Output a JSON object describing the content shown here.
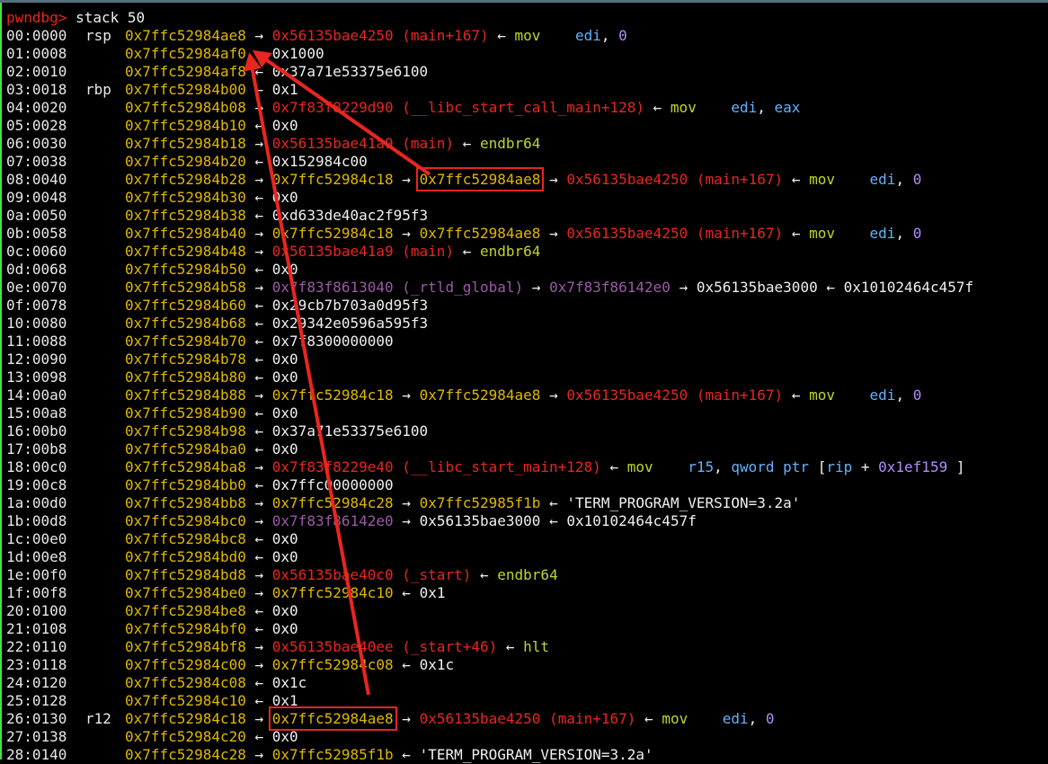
{
  "prompt": "pwndbg>",
  "command": "stack 50",
  "arrows": {
    "forward": "→",
    "back": "←"
  },
  "colors": {
    "stack": "#e0b800",
    "code": "#e8261f",
    "rwx": "#9b5aa6",
    "instr": "#c2d42a",
    "register": "#63b2ff",
    "immediate": "#b28cff",
    "highlight": "#e8261f"
  },
  "rows": [
    {
      "off": "00:0000",
      "reg": "rsp",
      "addr": "0x7ffc52984ae8",
      "chain": [
        {
          "t": "a",
          "v": "→"
        },
        {
          "t": "code",
          "v": "0x56135bae4250 (main+167)"
        },
        {
          "t": "a",
          "v": "←"
        },
        {
          "t": "instr",
          "v": "mov    "
        },
        {
          "t": "opr",
          "v": "edi"
        },
        {
          "t": "plain",
          "v": ", "
        },
        {
          "t": "imm",
          "v": "0"
        }
      ]
    },
    {
      "off": "01:0008",
      "reg": "",
      "addr": "0x7ffc52984af0",
      "chain": [
        {
          "t": "a",
          "v": "←"
        },
        {
          "t": "plain",
          "v": "0x1000"
        }
      ]
    },
    {
      "off": "02:0010",
      "reg": "",
      "addr": "0x7ffc52984af8",
      "chain": [
        {
          "t": "a",
          "v": "←"
        },
        {
          "t": "plain",
          "v": "0x37a71e53375e6100"
        }
      ]
    },
    {
      "off": "03:0018",
      "reg": "rbp",
      "addr": "0x7ffc52984b00",
      "chain": [
        {
          "t": "a",
          "v": "←"
        },
        {
          "t": "plain",
          "v": "0x1"
        }
      ]
    },
    {
      "off": "04:0020",
      "reg": "",
      "addr": "0x7ffc52984b08",
      "chain": [
        {
          "t": "a",
          "v": "→"
        },
        {
          "t": "code",
          "v": "0x7f83f8229d90 (__libc_start_call_main+128)"
        },
        {
          "t": "a",
          "v": "←"
        },
        {
          "t": "instr",
          "v": "mov    "
        },
        {
          "t": "opr",
          "v": "edi"
        },
        {
          "t": "plain",
          "v": ", "
        },
        {
          "t": "opr",
          "v": "eax"
        }
      ]
    },
    {
      "off": "05:0028",
      "reg": "",
      "addr": "0x7ffc52984b10",
      "chain": [
        {
          "t": "a",
          "v": "←"
        },
        {
          "t": "plain",
          "v": "0x0"
        }
      ]
    },
    {
      "off": "06:0030",
      "reg": "",
      "addr": "0x7ffc52984b18",
      "chain": [
        {
          "t": "a",
          "v": "→"
        },
        {
          "t": "code",
          "v": "0x56135bae41a9 (main)"
        },
        {
          "t": "a",
          "v": "←"
        },
        {
          "t": "instr",
          "v": "endbr64"
        }
      ]
    },
    {
      "off": "07:0038",
      "reg": "",
      "addr": "0x7ffc52984b20",
      "chain": [
        {
          "t": "a",
          "v": "←"
        },
        {
          "t": "plain",
          "v": "0x152984c00"
        }
      ]
    },
    {
      "off": "08:0040",
      "reg": "",
      "addr": "0x7ffc52984b28",
      "chain": [
        {
          "t": "a",
          "v": "→"
        },
        {
          "t": "sp",
          "v": "0x7ffc52984c18"
        },
        {
          "t": "a",
          "v": "→"
        },
        {
          "t": "sp",
          "v": "0x7ffc52984ae8",
          "hl": true
        },
        {
          "t": "a",
          "v": "→"
        },
        {
          "t": "code",
          "v": "0x56135bae4250 (main+167)"
        },
        {
          "t": "a",
          "v": "←"
        },
        {
          "t": "instr",
          "v": "mov    "
        },
        {
          "t": "opr",
          "v": "edi"
        },
        {
          "t": "plain",
          "v": ", "
        },
        {
          "t": "imm",
          "v": "0"
        }
      ]
    },
    {
      "off": "09:0048",
      "reg": "",
      "addr": "0x7ffc52984b30",
      "chain": [
        {
          "t": "a",
          "v": "←"
        },
        {
          "t": "plain",
          "v": "0x0"
        }
      ]
    },
    {
      "off": "0a:0050",
      "reg": "",
      "addr": "0x7ffc52984b38",
      "chain": [
        {
          "t": "a",
          "v": "←"
        },
        {
          "t": "plain",
          "v": "0xd633de40ac2f95f3"
        }
      ]
    },
    {
      "off": "0b:0058",
      "reg": "",
      "addr": "0x7ffc52984b40",
      "chain": [
        {
          "t": "a",
          "v": "→"
        },
        {
          "t": "sp",
          "v": "0x7ffc52984c18"
        },
        {
          "t": "a",
          "v": "→"
        },
        {
          "t": "sp",
          "v": "0x7ffc52984ae8"
        },
        {
          "t": "a",
          "v": "→"
        },
        {
          "t": "code",
          "v": "0x56135bae4250 (main+167)"
        },
        {
          "t": "a",
          "v": "←"
        },
        {
          "t": "instr",
          "v": "mov    "
        },
        {
          "t": "opr",
          "v": "edi"
        },
        {
          "t": "plain",
          "v": ", "
        },
        {
          "t": "imm",
          "v": "0"
        }
      ]
    },
    {
      "off": "0c:0060",
      "reg": "",
      "addr": "0x7ffc52984b48",
      "chain": [
        {
          "t": "a",
          "v": "→"
        },
        {
          "t": "code",
          "v": "0x56135bae41a9 (main)"
        },
        {
          "t": "a",
          "v": "←"
        },
        {
          "t": "instr",
          "v": "endbr64"
        }
      ]
    },
    {
      "off": "0d:0068",
      "reg": "",
      "addr": "0x7ffc52984b50",
      "chain": [
        {
          "t": "a",
          "v": "←"
        },
        {
          "t": "plain",
          "v": "0x0"
        }
      ]
    },
    {
      "off": "0e:0070",
      "reg": "",
      "addr": "0x7ffc52984b58",
      "chain": [
        {
          "t": "a",
          "v": "→"
        },
        {
          "t": "rwx",
          "v": "0x7f83f8613040 (_rtld_global)"
        },
        {
          "t": "a",
          "v": "→"
        },
        {
          "t": "rwx",
          "v": "0x7f83f86142e0"
        },
        {
          "t": "a",
          "v": "→"
        },
        {
          "t": "plain",
          "v": "0x56135bae3000"
        },
        {
          "t": "a",
          "v": "←"
        },
        {
          "t": "plain",
          "v": "0x10102464c457f"
        }
      ]
    },
    {
      "off": "0f:0078",
      "reg": "",
      "addr": "0x7ffc52984b60",
      "chain": [
        {
          "t": "a",
          "v": "←"
        },
        {
          "t": "plain",
          "v": "0x29cb7b703a0d95f3"
        }
      ]
    },
    {
      "off": "10:0080",
      "reg": "",
      "addr": "0x7ffc52984b68",
      "chain": [
        {
          "t": "a",
          "v": "←"
        },
        {
          "t": "plain",
          "v": "0x29342e0596a595f3"
        }
      ]
    },
    {
      "off": "11:0088",
      "reg": "",
      "addr": "0x7ffc52984b70",
      "chain": [
        {
          "t": "a",
          "v": "←"
        },
        {
          "t": "plain",
          "v": "0x7f8300000000"
        }
      ]
    },
    {
      "off": "12:0090",
      "reg": "",
      "addr": "0x7ffc52984b78",
      "chain": [
        {
          "t": "a",
          "v": "←"
        },
        {
          "t": "plain",
          "v": "0x0"
        }
      ]
    },
    {
      "off": "13:0098",
      "reg": "",
      "addr": "0x7ffc52984b80",
      "chain": [
        {
          "t": "a",
          "v": "←"
        },
        {
          "t": "plain",
          "v": "0x0"
        }
      ]
    },
    {
      "off": "14:00a0",
      "reg": "",
      "addr": "0x7ffc52984b88",
      "chain": [
        {
          "t": "a",
          "v": "→"
        },
        {
          "t": "sp",
          "v": "0x7ffc52984c18"
        },
        {
          "t": "a",
          "v": "→"
        },
        {
          "t": "sp",
          "v": "0x7ffc52984ae8"
        },
        {
          "t": "a",
          "v": "→"
        },
        {
          "t": "code",
          "v": "0x56135bae4250 (main+167)"
        },
        {
          "t": "a",
          "v": "←"
        },
        {
          "t": "instr",
          "v": "mov    "
        },
        {
          "t": "opr",
          "v": "edi"
        },
        {
          "t": "plain",
          "v": ", "
        },
        {
          "t": "imm",
          "v": "0"
        }
      ]
    },
    {
      "off": "15:00a8",
      "reg": "",
      "addr": "0x7ffc52984b90",
      "chain": [
        {
          "t": "a",
          "v": "←"
        },
        {
          "t": "plain",
          "v": "0x0"
        }
      ]
    },
    {
      "off": "16:00b0",
      "reg": "",
      "addr": "0x7ffc52984b98",
      "chain": [
        {
          "t": "a",
          "v": "←"
        },
        {
          "t": "plain",
          "v": "0x37a71e53375e6100"
        }
      ]
    },
    {
      "off": "17:00b8",
      "reg": "",
      "addr": "0x7ffc52984ba0",
      "chain": [
        {
          "t": "a",
          "v": "←"
        },
        {
          "t": "plain",
          "v": "0x0"
        }
      ]
    },
    {
      "off": "18:00c0",
      "reg": "",
      "addr": "0x7ffc52984ba8",
      "chain": [
        {
          "t": "a",
          "v": "→"
        },
        {
          "t": "code",
          "v": "0x7f83f8229e40 (__libc_start_main+128)"
        },
        {
          "t": "a",
          "v": "←"
        },
        {
          "t": "instr",
          "v": "mov    "
        },
        {
          "t": "opr",
          "v": "r15"
        },
        {
          "t": "plain",
          "v": ", "
        },
        {
          "t": "opr",
          "v": "qword ptr"
        },
        {
          "t": "plain",
          "v": " ["
        },
        {
          "t": "opr",
          "v": "rip"
        },
        {
          "t": "plain",
          "v": " + "
        },
        {
          "t": "imm",
          "v": "0x1ef159"
        },
        {
          "t": "plain",
          "v": "]"
        }
      ]
    },
    {
      "off": "19:00c8",
      "reg": "",
      "addr": "0x7ffc52984bb0",
      "chain": [
        {
          "t": "a",
          "v": "←"
        },
        {
          "t": "plain",
          "v": "0x7ffc00000000"
        }
      ]
    },
    {
      "off": "1a:00d0",
      "reg": "",
      "addr": "0x7ffc52984bb8",
      "chain": [
        {
          "t": "a",
          "v": "→"
        },
        {
          "t": "sp",
          "v": "0x7ffc52984c28"
        },
        {
          "t": "a",
          "v": "→"
        },
        {
          "t": "sp",
          "v": "0x7ffc52985f1b"
        },
        {
          "t": "a",
          "v": "←"
        },
        {
          "t": "plain",
          "v": "'TERM_PROGRAM_VERSION=3.2a'"
        }
      ]
    },
    {
      "off": "1b:00d8",
      "reg": "",
      "addr": "0x7ffc52984bc0",
      "chain": [
        {
          "t": "a",
          "v": "→"
        },
        {
          "t": "rwx",
          "v": "0x7f83f86142e0"
        },
        {
          "t": "a",
          "v": "→"
        },
        {
          "t": "plain",
          "v": "0x56135bae3000"
        },
        {
          "t": "a",
          "v": "←"
        },
        {
          "t": "plain",
          "v": "0x10102464c457f"
        }
      ]
    },
    {
      "off": "1c:00e0",
      "reg": "",
      "addr": "0x7ffc52984bc8",
      "chain": [
        {
          "t": "a",
          "v": "←"
        },
        {
          "t": "plain",
          "v": "0x0"
        }
      ]
    },
    {
      "off": "1d:00e8",
      "reg": "",
      "addr": "0x7ffc52984bd0",
      "chain": [
        {
          "t": "a",
          "v": "←"
        },
        {
          "t": "plain",
          "v": "0x0"
        }
      ]
    },
    {
      "off": "1e:00f0",
      "reg": "",
      "addr": "0x7ffc52984bd8",
      "chain": [
        {
          "t": "a",
          "v": "→"
        },
        {
          "t": "code",
          "v": "0x56135bae40c0 (_start)"
        },
        {
          "t": "a",
          "v": "←"
        },
        {
          "t": "instr",
          "v": "endbr64"
        }
      ]
    },
    {
      "off": "1f:00f8",
      "reg": "",
      "addr": "0x7ffc52984be0",
      "chain": [
        {
          "t": "a",
          "v": "→"
        },
        {
          "t": "sp",
          "v": "0x7ffc52984c10"
        },
        {
          "t": "a",
          "v": "←"
        },
        {
          "t": "plain",
          "v": "0x1"
        }
      ]
    },
    {
      "off": "20:0100",
      "reg": "",
      "addr": "0x7ffc52984be8",
      "chain": [
        {
          "t": "a",
          "v": "←"
        },
        {
          "t": "plain",
          "v": "0x0"
        }
      ]
    },
    {
      "off": "21:0108",
      "reg": "",
      "addr": "0x7ffc52984bf0",
      "chain": [
        {
          "t": "a",
          "v": "←"
        },
        {
          "t": "plain",
          "v": "0x0"
        }
      ]
    },
    {
      "off": "22:0110",
      "reg": "",
      "addr": "0x7ffc52984bf8",
      "chain": [
        {
          "t": "a",
          "v": "→"
        },
        {
          "t": "code",
          "v": "0x56135bae40ee (_start+46)"
        },
        {
          "t": "a",
          "v": "←"
        },
        {
          "t": "instr",
          "v": "hlt"
        }
      ]
    },
    {
      "off": "23:0118",
      "reg": "",
      "addr": "0x7ffc52984c00",
      "chain": [
        {
          "t": "a",
          "v": "→"
        },
        {
          "t": "sp",
          "v": "0x7ffc52984c08"
        },
        {
          "t": "a",
          "v": "←"
        },
        {
          "t": "plain",
          "v": "0x1c"
        }
      ]
    },
    {
      "off": "24:0120",
      "reg": "",
      "addr": "0x7ffc52984c08",
      "chain": [
        {
          "t": "a",
          "v": "←"
        },
        {
          "t": "plain",
          "v": "0x1c"
        }
      ]
    },
    {
      "off": "25:0128",
      "reg": "",
      "addr": "0x7ffc52984c10",
      "chain": [
        {
          "t": "a",
          "v": "←"
        },
        {
          "t": "plain",
          "v": "0x1"
        }
      ]
    },
    {
      "off": "26:0130",
      "reg": "r12",
      "addr": "0x7ffc52984c18",
      "chain": [
        {
          "t": "a",
          "v": "→"
        },
        {
          "t": "sp",
          "v": "0x7ffc52984ae8",
          "hl": true
        },
        {
          "t": "a",
          "v": "→"
        },
        {
          "t": "code",
          "v": "0x56135bae4250 (main+167)"
        },
        {
          "t": "a",
          "v": "←"
        },
        {
          "t": "instr",
          "v": "mov    "
        },
        {
          "t": "opr",
          "v": "edi"
        },
        {
          "t": "plain",
          "v": ", "
        },
        {
          "t": "imm",
          "v": "0"
        }
      ]
    },
    {
      "off": "27:0138",
      "reg": "",
      "addr": "0x7ffc52984c20",
      "chain": [
        {
          "t": "a",
          "v": "←"
        },
        {
          "t": "plain",
          "v": "0x0"
        }
      ]
    },
    {
      "off": "28:0140",
      "reg": "",
      "addr": "0x7ffc52984c28",
      "chain": [
        {
          "t": "a",
          "v": "→"
        },
        {
          "t": "sp",
          "v": "0x7ffc52985f1b"
        },
        {
          "t": "a",
          "v": "←"
        },
        {
          "t": "plain",
          "v": "'TERM_PROGRAM_VERSION=3.2a'"
        }
      ]
    }
  ]
}
